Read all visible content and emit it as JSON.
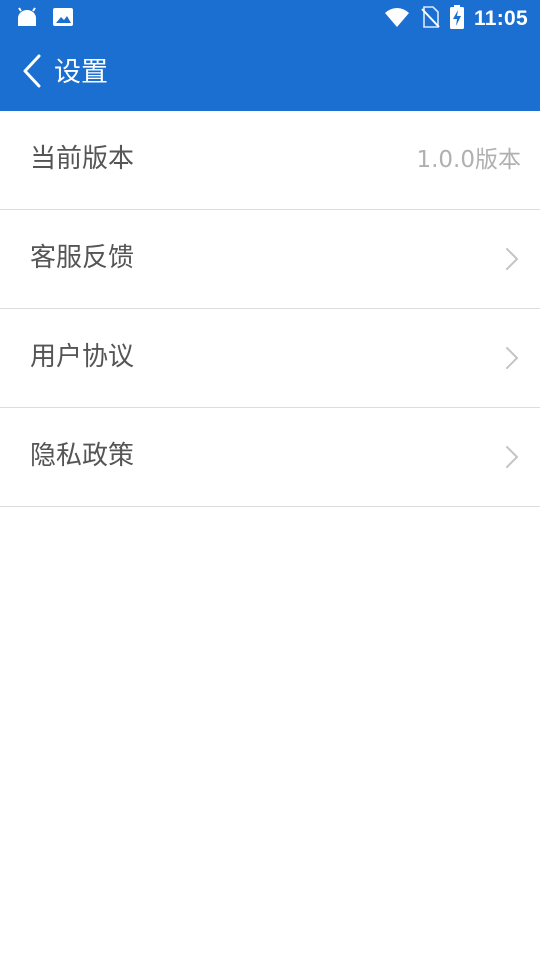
{
  "status_bar": {
    "time": "11:05",
    "icons": [
      "android-icon",
      "image-icon",
      "wifi-icon",
      "no-sim-icon",
      "battery-charging-icon"
    ]
  },
  "toolbar": {
    "title": "设置",
    "back_icon": "chevron-left-icon"
  },
  "settings": {
    "items": [
      {
        "label": "当前版本",
        "value": "1.0.0版本"
      },
      {
        "label": "客服反馈",
        "icon": "chevron-right-icon"
      },
      {
        "label": "用户协议",
        "icon": "chevron-right-icon"
      },
      {
        "label": "隐私政策",
        "icon": "chevron-right-icon"
      }
    ]
  },
  "colors": {
    "primary": "#1a6fd0",
    "divider": "#dddddd",
    "label": "#555555",
    "secondary_text": "#b0b0b0"
  }
}
